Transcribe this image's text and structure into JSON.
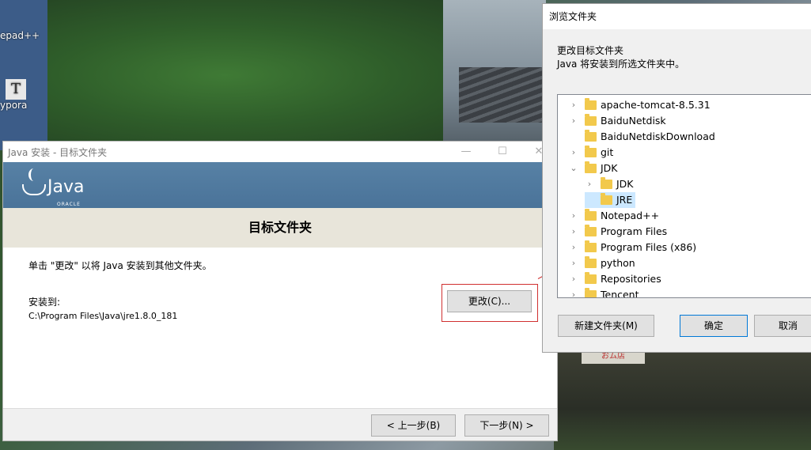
{
  "desktop": {
    "icons": [
      {
        "label": "epad++"
      },
      {
        "label": "ypora",
        "glyph": "T"
      }
    ],
    "sign_text": "おム店"
  },
  "java_installer": {
    "window_title": "Java 安装 - 目标文件夹",
    "controls": {
      "minimize": "—",
      "maximize": "☐",
      "close": "✕"
    },
    "logo_text": "Java",
    "logo_sub": "ORACLE",
    "heading": "目标文件夹",
    "instruction": "单击 \"更改\" 以将 Java 安装到其他文件夹。",
    "install_to_label": "安装到:",
    "install_path": "C:\\Program Files\\Java\\jre1.8.0_181",
    "change_button": "更改(C)...",
    "back_button": "< 上一步(B)",
    "next_button": "下一步(N) >"
  },
  "browse_dialog": {
    "title": "浏览文件夹",
    "desc_line1": "更改目标文件夹",
    "desc_line2": "Java 将安装到所选文件夹中。",
    "tree_items": [
      {
        "label": "apache-tomcat-8.5.31",
        "level": 0,
        "expand": ">"
      },
      {
        "label": "BaiduNetdisk",
        "level": 0,
        "expand": ">"
      },
      {
        "label": "BaiduNetdiskDownload",
        "level": 0,
        "expand": ""
      },
      {
        "label": "git",
        "level": 0,
        "expand": ">"
      },
      {
        "label": "JDK",
        "level": 0,
        "expand": "v"
      },
      {
        "label": "JDK",
        "level": 1,
        "expand": ">"
      },
      {
        "label": "JRE",
        "level": 1,
        "expand": "",
        "selected": true
      },
      {
        "label": "Notepad++",
        "level": 0,
        "expand": ">"
      },
      {
        "label": "Program Files",
        "level": 0,
        "expand": ">"
      },
      {
        "label": "Program Files (x86)",
        "level": 0,
        "expand": ">"
      },
      {
        "label": "python",
        "level": 0,
        "expand": ">"
      },
      {
        "label": "Repositories",
        "level": 0,
        "expand": ">"
      },
      {
        "label": "Tencent",
        "level": 0,
        "expand": ">"
      }
    ],
    "new_folder_button": "新建文件夹(M)",
    "ok_button": "确定",
    "cancel_button": "取消"
  }
}
